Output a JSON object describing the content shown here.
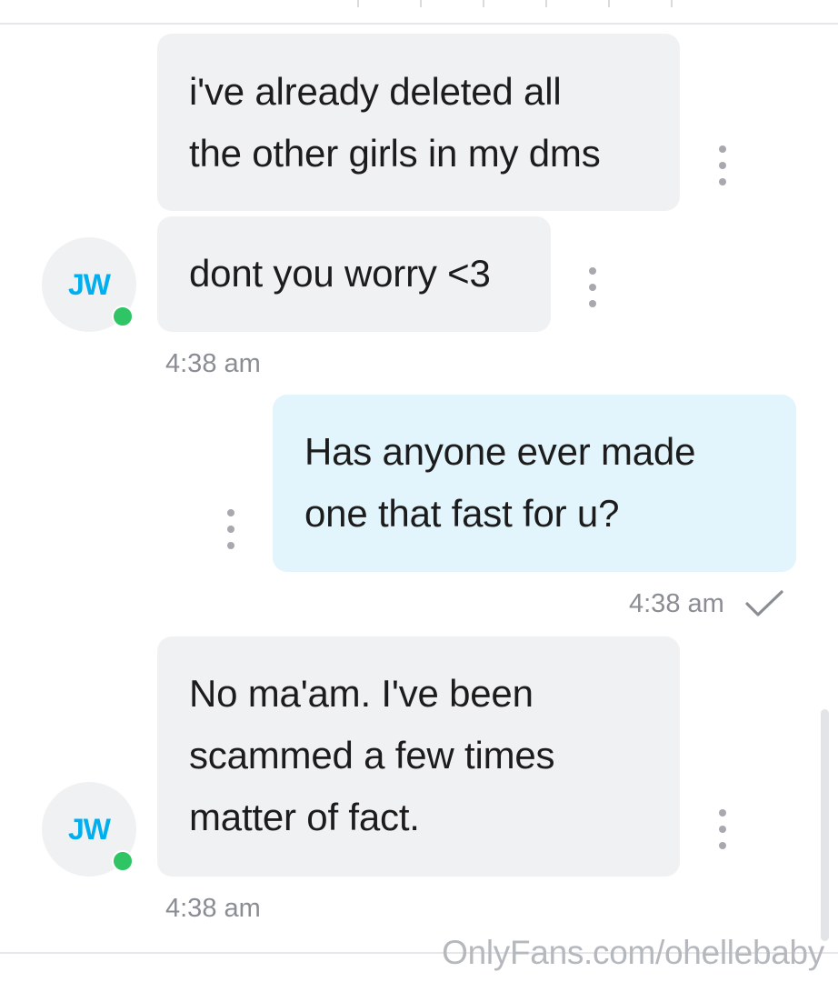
{
  "conversation": {
    "messages": [
      {
        "sender": "incoming",
        "avatar_initials": "JW",
        "bubbles": [
          "i've already deleted all\nthe other girls in my dms",
          "dont you worry <3"
        ],
        "time": "4:38 am"
      },
      {
        "sender": "outgoing",
        "bubbles": [
          "Has anyone ever made\none that fast for u?"
        ],
        "time": "4:38 am",
        "status_icon": "check-icon"
      },
      {
        "sender": "incoming",
        "avatar_initials": "JW",
        "bubbles": [
          "No ma'am. I've been\nscammed a few times\nmatter of fact."
        ],
        "time": "4:38 am"
      }
    ]
  },
  "watermark": "OnlyFans.com/ohellebaby",
  "colors": {
    "incoming_bubble": "#f0f1f3",
    "outgoing_bubble": "#e2f4fc",
    "avatar_initials": "#00aff0",
    "online_indicator": "#2fc565",
    "timestamp": "#8a8d93",
    "watermark": "#b5b8bd"
  },
  "icons": [
    "more-options-icon",
    "check-icon",
    "online-status-icon"
  ]
}
